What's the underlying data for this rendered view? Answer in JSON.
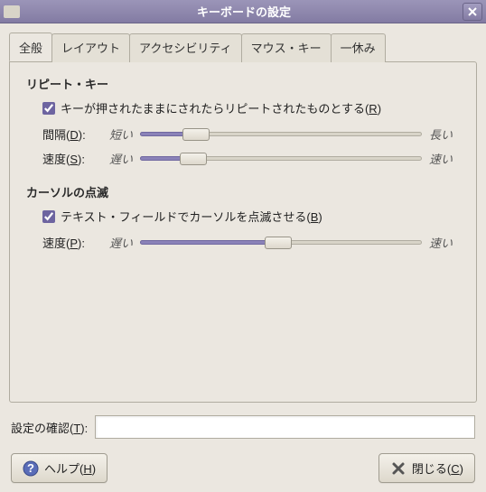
{
  "window": {
    "title": "キーボードの設定"
  },
  "tabs": [
    {
      "label": "全般",
      "active": true
    },
    {
      "label": "レイアウト",
      "active": false
    },
    {
      "label": "アクセシビリティ",
      "active": false
    },
    {
      "label": "マウス・キー",
      "active": false
    },
    {
      "label": "一休み",
      "active": false
    }
  ],
  "repeat": {
    "title": "リピート・キー",
    "checkbox_label": "キーが押されたままにされたらリピートされたものとする(",
    "checkbox_key": "R",
    "checkbox_suffix": ")",
    "checked": true,
    "delay": {
      "label_pre": "間隔(",
      "key": "D",
      "label_post": "):",
      "left": "短い",
      "right": "長い",
      "percent": 20
    },
    "speed": {
      "label_pre": "速度(",
      "key": "S",
      "label_post": "):",
      "left": "遅い",
      "right": "速い",
      "percent": 19
    }
  },
  "cursor": {
    "title": "カーソルの点滅",
    "checkbox_label": "テキスト・フィールドでカーソルを点滅させる(",
    "checkbox_key": "B",
    "checkbox_suffix": ")",
    "checked": true,
    "speed": {
      "label_pre": "速度(",
      "key": "P",
      "label_post": "):",
      "left": "遅い",
      "right": "速い",
      "percent": 49
    }
  },
  "confirm": {
    "label_pre": "設定の確認(",
    "key": "T",
    "label_post": "):",
    "value": ""
  },
  "buttons": {
    "help_pre": "ヘルプ(",
    "help_key": "H",
    "help_post": ")",
    "close_pre": "閉じる(",
    "close_key": "C",
    "close_post": ")"
  }
}
